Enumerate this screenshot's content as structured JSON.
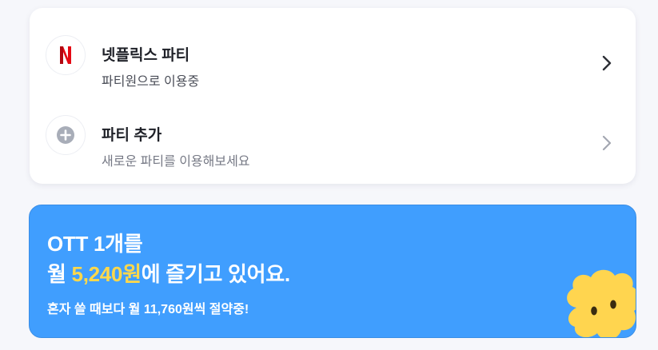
{
  "party_list": {
    "items": [
      {
        "title": "넷플릭스 파티",
        "subtitle": "파티원으로 이용중",
        "icon": "netflix-logo-icon"
      },
      {
        "title": "파티 추가",
        "subtitle": "새로운 파티를 이용해보세요",
        "icon": "plus-circle-icon"
      }
    ]
  },
  "banner": {
    "line1": "OTT 1개를",
    "line2_prefix": "월 ",
    "line2_amount": "5,240원",
    "line2_suffix": "에 즐기고 있어요.",
    "subtext": "혼자 쓸 때보다 월 11,760원씩 절약중!"
  },
  "colors": {
    "banner_bg": "#409efe",
    "highlight": "#ffd84a",
    "netflix_red": "#e50914",
    "mascot_yellow": "#ffd54f"
  }
}
